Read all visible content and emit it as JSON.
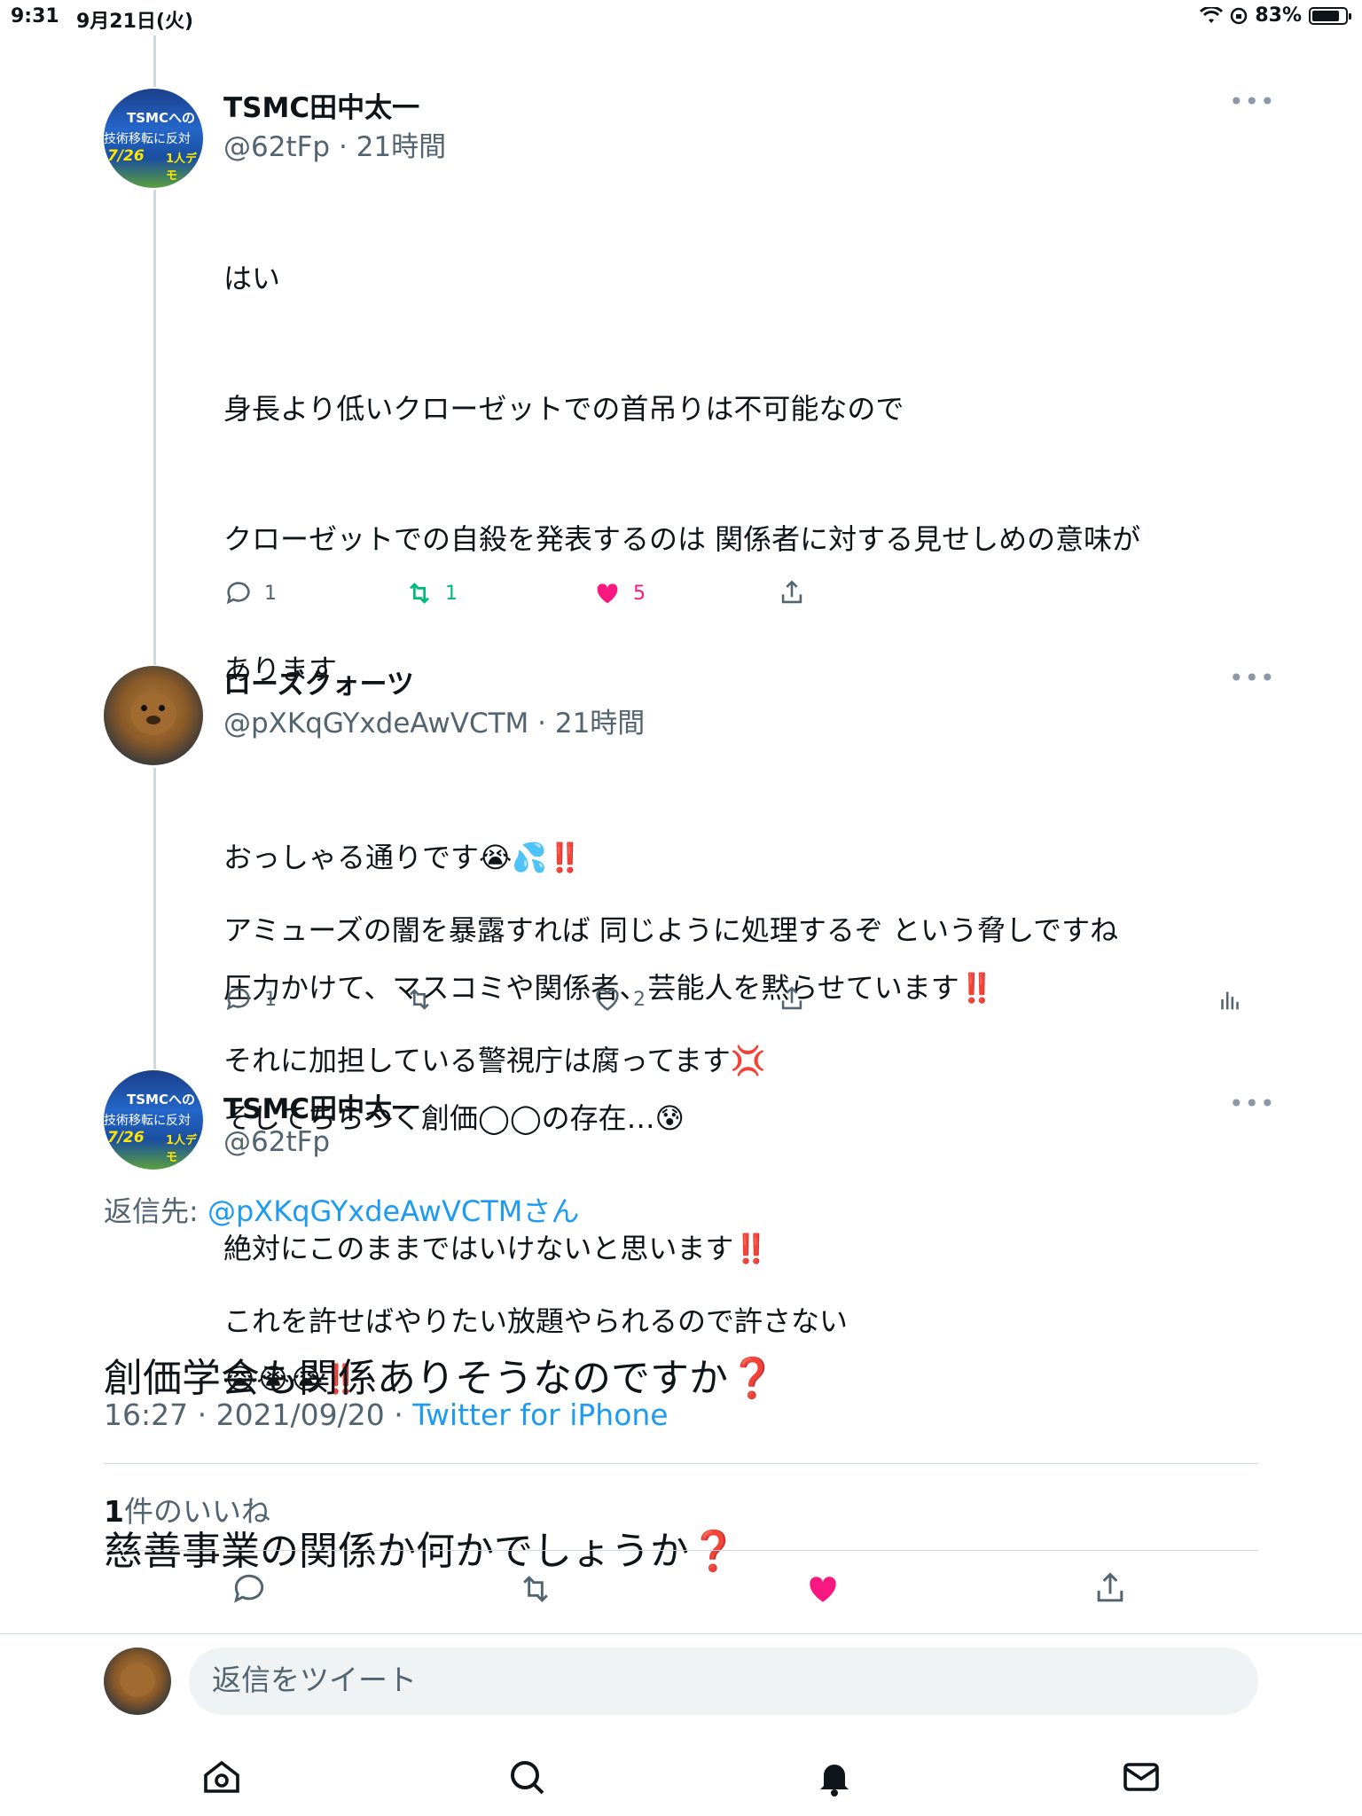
{
  "status_bar": {
    "time": "9:31",
    "date": "9月21日(火)",
    "battery": "83%",
    "battery_level": 0.83
  },
  "tweets": [
    {
      "name": "TSMC田中太一",
      "handle": "@62tFp",
      "age": "21時間",
      "avatar_text": [
        "TSMCへの",
        "技術移転に反対",
        "7/26",
        "1人デモ"
      ],
      "lines": [
        "はい",
        "身長より低いクローゼットでの首吊りは不可能なので",
        "クローゼットでの自殺を発表するのは 関係者に対する見せしめの意味が",
        "あります",
        "",
        "アミューズの闇を暴露すれば 同じように処理するぞ という脅しですね",
        "それに加担している警視庁は腐ってます💢",
        "",
        "これを許せばやりたい放題やられるので許さない"
      ],
      "replies": "1",
      "retweets": "1",
      "likes": "5"
    },
    {
      "name": "ローズクォーツ",
      "handle": "@pXKqGYxdeAwVCTM",
      "age": "21時間",
      "lines": [
        "おっしゃる通りです😭💦‼️",
        "圧力かけて、マスコミや関係者、芸能人を黙らせています‼️",
        "そしてちらつく創価◯◯の存在…😰",
        "絶対にこのままではいけないと思います‼️",
        "😭😭😭‼️"
      ],
      "replies": "1",
      "retweets": "",
      "likes": "2"
    }
  ],
  "focus_tweet": {
    "name": "TSMC田中太一",
    "handle": "@62tFp",
    "reply_to_prefix": "返信先: ",
    "reply_to_handle": "@pXKqGYxdeAwVCTMさん",
    "line1": "創価学会も関係ありそうなのですか",
    "line2": "慈善事業の関係か何かでしょうか",
    "qmark": "❓",
    "timestamp": "16:27 · 2021/09/20 · ",
    "source": "Twitter for iPhone",
    "likes_count": "1",
    "likes_label": "件のいいね"
  },
  "reply_box": {
    "placeholder": "返信をツイート"
  },
  "colors": {
    "accent": "#1d9bf0",
    "like": "#f91880",
    "retweet": "#00ba7c",
    "muted": "#536471"
  },
  "icons": [
    "reply-icon",
    "retweet-icon",
    "like-icon",
    "share-icon",
    "analytics-icon",
    "home-icon",
    "search-icon",
    "notifications-icon",
    "messages-icon",
    "more-icon"
  ]
}
